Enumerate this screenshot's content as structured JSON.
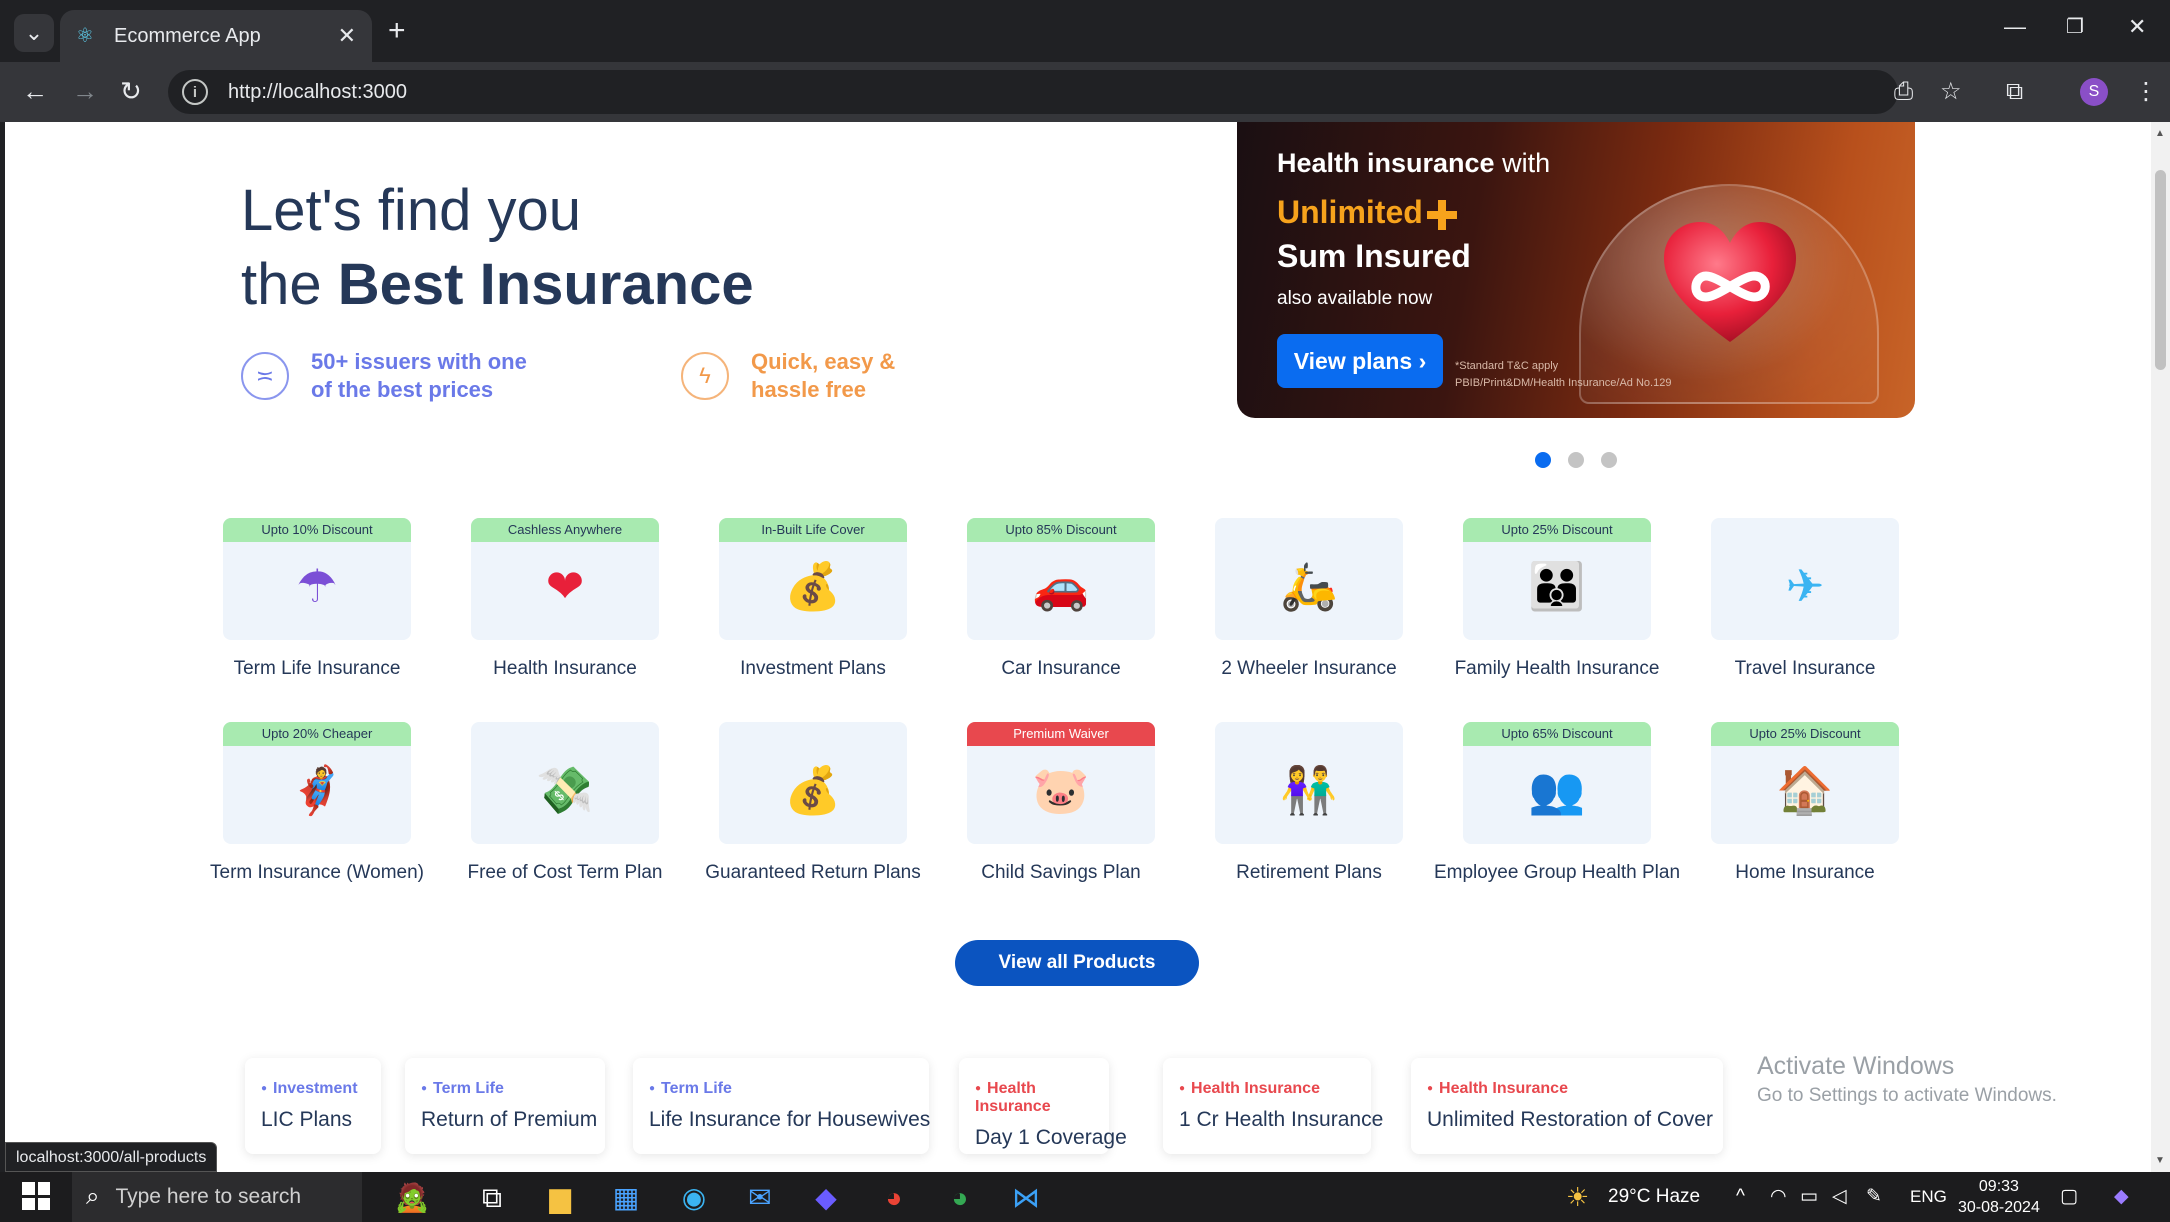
{
  "browser": {
    "tab_title": "Ecommerce App",
    "url": "http://localhost:3000",
    "profile_initial": "S",
    "status_url": "localhost:3000/all-products"
  },
  "hero": {
    "line1": "Let's find you",
    "line2_prefix": "the ",
    "line2_bold": "Best Insurance",
    "features": [
      {
        "text": "50+ issuers with one of the best prices",
        "color": "#6a79e8"
      },
      {
        "text": "Quick, easy & hassle free",
        "color": "#f2994a"
      }
    ]
  },
  "banner": {
    "line1_bold": "Health insurance",
    "line1_rest": " with",
    "line2": "Unlimited",
    "line3": "Sum Insured",
    "line4": "also available now",
    "button": "View plans ›",
    "tc1": "*Standard T&C apply",
    "tc2": "PBIB/Print&DM/Health Insurance/Ad No.129"
  },
  "carousel": {
    "total": 3,
    "active": 0
  },
  "products": [
    {
      "label": "Term Life Insurance",
      "badge": "Upto 10% Discount",
      "badge_color": "green",
      "icon": "umbrella-icon"
    },
    {
      "label": "Health Insurance",
      "badge": "Cashless Anywhere",
      "badge_color": "green",
      "icon": "heart-icon"
    },
    {
      "label": "Investment Plans",
      "badge": "In-Built Life Cover",
      "badge_color": "green",
      "icon": "coins-growth-icon"
    },
    {
      "label": "Car Insurance",
      "badge": "Upto 85% Discount",
      "badge_color": "green",
      "icon": "car-icon"
    },
    {
      "label": "2 Wheeler Insurance",
      "badge": "",
      "badge_color": "",
      "icon": "scooter-icon"
    },
    {
      "label": "Family Health Insurance",
      "badge": "Upto 25% Discount",
      "badge_color": "green",
      "icon": "family-icon"
    },
    {
      "label": "Travel Insurance",
      "badge": "",
      "badge_color": "",
      "icon": "airplane-icon"
    },
    {
      "label": "Term Insurance (Women)",
      "badge": "Upto 20% Cheaper",
      "badge_color": "green",
      "icon": "superwoman-icon"
    },
    {
      "label": "Free of Cost Term Plan",
      "badge": "",
      "badge_color": "",
      "icon": "money-hand-icon"
    },
    {
      "label": "Guaranteed Return Plans",
      "badge": "",
      "badge_color": "",
      "icon": "money-bag-icon"
    },
    {
      "label": "Child Savings Plan",
      "badge": "Premium Waiver",
      "badge_color": "red",
      "icon": "child-piggy-icon"
    },
    {
      "label": "Retirement Plans",
      "badge": "",
      "badge_color": "",
      "icon": "elderly-couple-icon"
    },
    {
      "label": "Employee Group Health Plan",
      "badge": "Upto 65% Discount",
      "badge_color": "green",
      "icon": "employees-icon"
    },
    {
      "label": "Home Insurance",
      "badge": "Upto 25% Discount",
      "badge_color": "green",
      "icon": "house-icon"
    }
  ],
  "view_all": "View all Products",
  "chips": [
    {
      "category": "Investment",
      "name": "LIC Plans",
      "color": "#6a79e8"
    },
    {
      "category": "Term Life",
      "name": "Return of Premium",
      "color": "#6a79e8"
    },
    {
      "category": "Term Life",
      "name": "Life Insurance for Housewives",
      "color": "#6a79e8"
    },
    {
      "category": "Health Insurance",
      "name": "Day 1 Coverage",
      "color": "#e8484e"
    },
    {
      "category": "Health Insurance",
      "name": "1 Cr Health Insurance",
      "color": "#e8484e"
    },
    {
      "category": "Health Insurance",
      "name": "Unlimited Restoration of Cover",
      "color": "#e8484e"
    }
  ],
  "watermark": {
    "title": "Activate Windows",
    "subtitle": "Go to Settings to activate Windows."
  },
  "taskbar": {
    "search_placeholder": "Type here to search",
    "weather": "29°C  Haze",
    "language": "ENG",
    "time": "09:33",
    "date": "30-08-2024"
  }
}
